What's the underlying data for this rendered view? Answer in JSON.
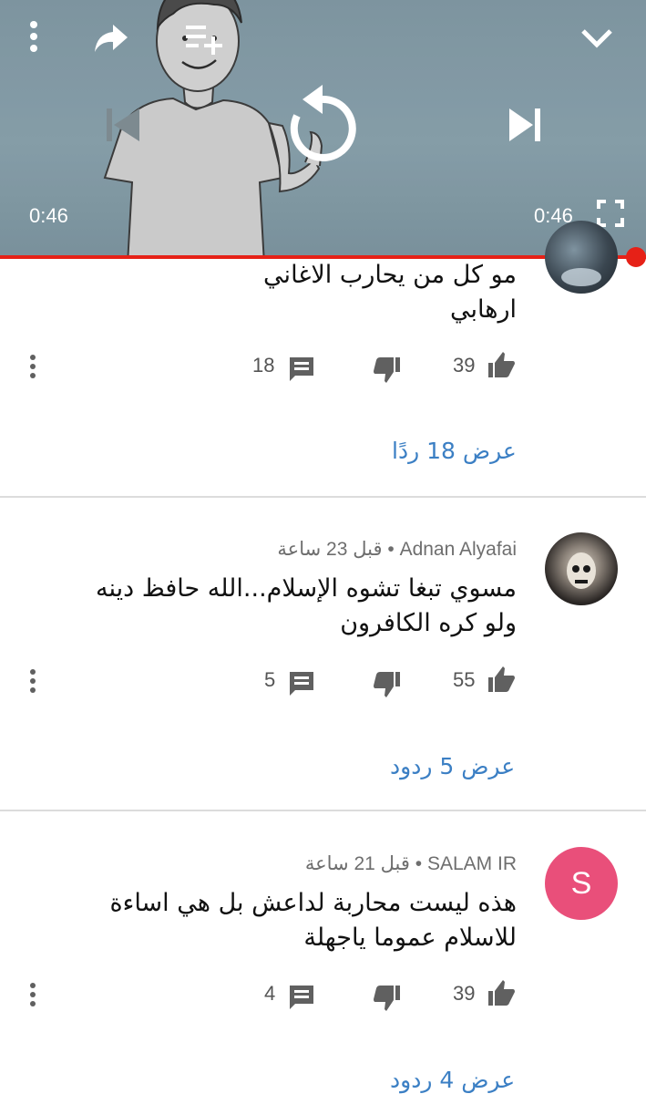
{
  "player": {
    "elapsed": "0:46",
    "duration": "0:46",
    "progress_fraction": 1.0,
    "colors": {
      "progress": "#e62117",
      "overlay_icons": "#ffffff"
    },
    "icons": [
      "more-vert-icon",
      "share-icon",
      "add-to-playlist-icon",
      "minimize-chevron-icon",
      "previous-icon",
      "replay-icon",
      "next-icon",
      "fullscreen-icon"
    ]
  },
  "comments": [
    {
      "author": "",
      "time": "",
      "lines": [
        "مو كل من يحارب الاغاني",
        "ارهابي"
      ],
      "likes": "39",
      "replies_count": "18",
      "view_replies": "عرض 18 ردًا"
    },
    {
      "author": "Adnan Alyafai",
      "time": "قبل 23 ساعة",
      "lines": [
        "مسوي تبغا تشوه الإسلام...الله حافظ دينه",
        "ولو كره الكافرون"
      ],
      "likes": "55",
      "replies_count": "5",
      "view_replies": "عرض 5 ردود"
    },
    {
      "author": "SALAM IR",
      "time": "قبل 21 ساعة",
      "avatar_letter": "S",
      "avatar_color": "#e94f7a",
      "lines": [
        "هذه ليست محاربة لداعش بل هي اساءة",
        "للاسلام عموما ياجهلة"
      ],
      "likes": "39",
      "replies_count": "4",
      "view_replies": "عرض 4 ردود"
    }
  ],
  "separator": "•",
  "link_color": "#3b7fc4"
}
